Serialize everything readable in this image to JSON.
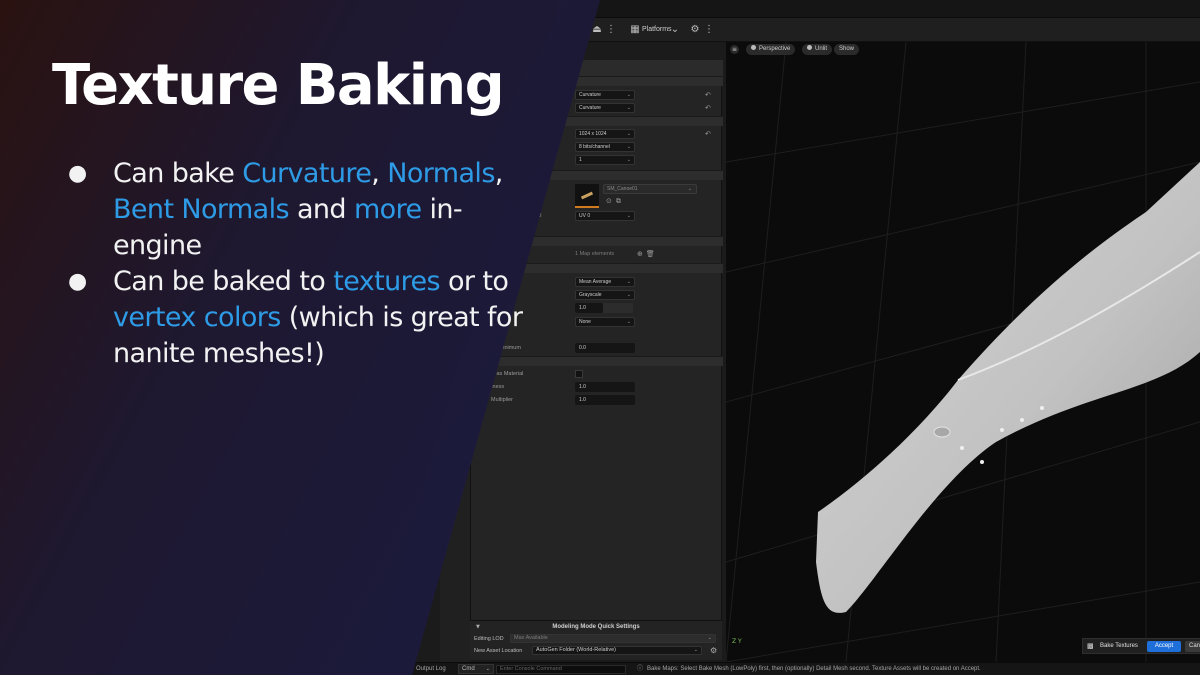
{
  "slide": {
    "title": "Texture Baking",
    "bullet1": {
      "p1": "Can bake ",
      "h1": "Curvature",
      "p2": ", ",
      "h2": "Normals",
      "p3": ", ",
      "h3": "Bent Normals",
      "p4": " and ",
      "h4": "more",
      "p5": " in-engine"
    },
    "bullet2": {
      "p1": "Can be baked to ",
      "h1": "textures",
      "p2": " or to ",
      "h2": "vertex colors",
      "p3": " (which is great for nanite meshes!)"
    },
    "bullet_glyph": "●",
    "colors": {
      "highlight": "#2e9be6",
      "title": "#ffffff",
      "panel_gradient_start": "#2a1210",
      "panel_gradient_end": "#1b1a3c"
    }
  },
  "toolbar": {
    "platforms_label": "Platforms"
  },
  "viewport": {
    "perspective_label": "Perspective",
    "unlit_label": "Unlit",
    "show_label": "Show",
    "axis_label": "Z Y"
  },
  "details": {
    "curvature_1": "Curvature",
    "curvature_2": "Curvature",
    "resolution": "1024 x 1024",
    "bit_depth": "8 bits/channel",
    "samples": "1",
    "mesh_name": "SM_Canoe01",
    "uv_label_fragment": "il",
    "uv_channel": "UV 0",
    "map_elements": "1 Map elements",
    "mean_average": "Mean Average",
    "grayscale": "Grayscale",
    "multiplier_label": "Multiplier",
    "multiplier_value": "1.0",
    "none_value": "None",
    "range_minimum_label": "ge Minimum",
    "range_minimum_value": "0.0",
    "preview_material_label": "w as Material",
    "brightness_label": "tness",
    "brightness_value": "1.0",
    "ao_multiplier_label": "Multiplier",
    "ao_multiplier_value": "1.0"
  },
  "quick_settings": {
    "title": "Modeling Mode Quick Settings",
    "editing_lod_label": "Editing LOD",
    "editing_lod_value": "Max Available",
    "asset_location_label": "New Asset Location",
    "asset_location_value": "AutoGen Folder (World-Relative)"
  },
  "statusbar": {
    "output_log": "Output Log",
    "cmd": "Cmd",
    "console_placeholder": "Enter Console Command",
    "message": "Bake Maps: Select Bake Mesh (LowPoly) first, then (optionally) Detail Mesh second. Texture Assets will be created on Accept."
  },
  "bake_panel": {
    "label": "Bake Textures",
    "accept": "Accept",
    "cancel": "Can"
  }
}
